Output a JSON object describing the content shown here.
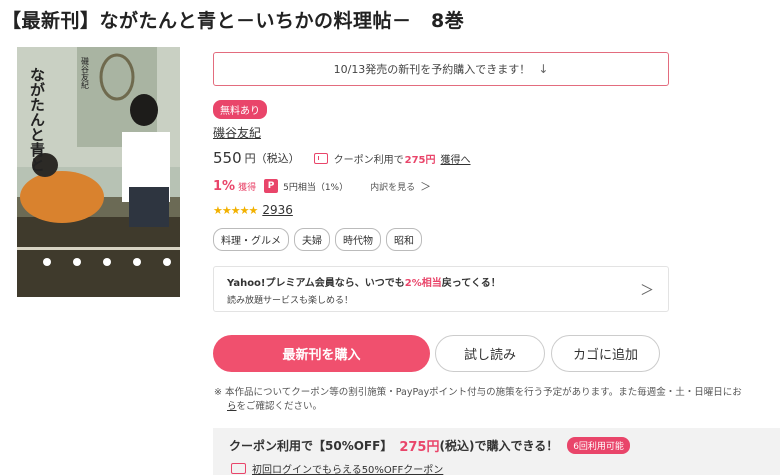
{
  "title": "【最新刊】ながたんと青と－いちかの料理帖－　8巻",
  "cover": {
    "title_text": "ながたんと青と",
    "author_text": "磯谷友紀"
  },
  "preorder": {
    "text": "10/13発売の新刊を予約購入できます！",
    "icon": "download-arrow-icon"
  },
  "badge_free": "無料あり",
  "author": "磯谷友紀",
  "price": {
    "value": "550",
    "unit": "円（税込）",
    "coupon_text": "クーポン利用で",
    "coupon_price": "275円",
    "coupon_link": "獲得へ"
  },
  "points": {
    "percent": "1%",
    "get_label": "獲得",
    "paypay_icon": "P",
    "equiv": "5円相当（1%）",
    "detail_link": "内訳を見る",
    "chevron": "＞"
  },
  "rating": {
    "stars": "★★★★★",
    "count": "2936",
    "value": 5
  },
  "tags": [
    "料理・グルメ",
    "夫婦",
    "時代物",
    "昭和"
  ],
  "yahoo": {
    "line1_a": "Yahoo!プレミアム会員なら、いつでも",
    "line1_hl": "2%相当",
    "line1_b": "戻ってくる！",
    "line2": "読み放題サービスも楽しめる！",
    "chevron": "＞"
  },
  "buttons": {
    "buy": "最新刊を購入",
    "try": "試し読み",
    "cart": "カゴに追加"
  },
  "notice": {
    "line1": "※ 本作品についてクーポン等の割引施策・PayPayポイント付与の施策を行う予定があります。また毎週金・土・日曜日にお",
    "line2_link": "ら",
    "line2_rest": "をご確認ください。"
  },
  "coupon_panel": {
    "line1_a": "クーポン利用で【50%OFF】",
    "price": "275円",
    "unit": "(税込)で購入できる！",
    "badge": "6回利用可能",
    "line2": "初回ログインでもらえる50%OFFクーポン"
  },
  "colors": {
    "accent": "#e9456a",
    "buy_button": "#f0506e",
    "star": "#f2b100"
  }
}
